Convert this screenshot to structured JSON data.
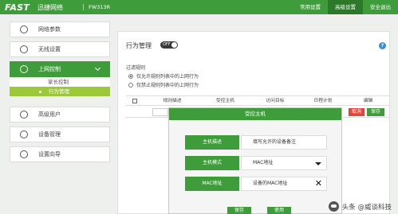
{
  "header": {
    "logo": "FAST",
    "brand": "迅捷网络",
    "model": "FW313R",
    "nav": [
      {
        "label": "常用设置"
      },
      {
        "label": "高级设置",
        "active": true
      },
      {
        "label": "安全退出"
      }
    ]
  },
  "sidebar": {
    "items": [
      {
        "label": "网络参数",
        "icon": "globe-icon"
      },
      {
        "label": "无线设置",
        "icon": "wifi-icon"
      },
      {
        "label": "上网控制",
        "icon": "power-icon",
        "active": true
      },
      {
        "label": "高级用户",
        "icon": "user-icon"
      },
      {
        "label": "设备管理",
        "icon": "device-icon"
      },
      {
        "label": "设置向导",
        "icon": "wizard-icon"
      }
    ],
    "subitems": [
      {
        "label": "家长控制"
      },
      {
        "label": "行为管理",
        "active": true
      }
    ]
  },
  "main": {
    "title": "行为管理",
    "toggle_label": "OFF",
    "help": "?",
    "rules_label": "过滤规则",
    "options": [
      {
        "label": "仅允许规则列表中的上网行为",
        "selected": true
      },
      {
        "label": "仅禁止规则列表中的上网行为",
        "selected": false
      }
    ],
    "table": {
      "headers": [
        "规则描述",
        "受控主机",
        "访问目标",
        "日程计划",
        "编辑"
      ]
    },
    "row_buttons": {
      "cancel": "取消",
      "save": "保存"
    }
  },
  "dialog": {
    "title": "受控主机",
    "fields": [
      {
        "label": "主机描述",
        "value": "填写允许的设备备注"
      },
      {
        "label": "主机模式",
        "value": "MAC地址"
      },
      {
        "label": "MAC地址",
        "value": "设备的MAC地址"
      }
    ],
    "buttons": {
      "save": "保存",
      "apply": "使用"
    }
  },
  "watermark": {
    "text": "头条 @威谈科技"
  },
  "colors": {
    "accent": "#3e9d3a",
    "active_sub": "#9dc83a",
    "danger": "#e2453c",
    "help": "#3b8fd4"
  }
}
